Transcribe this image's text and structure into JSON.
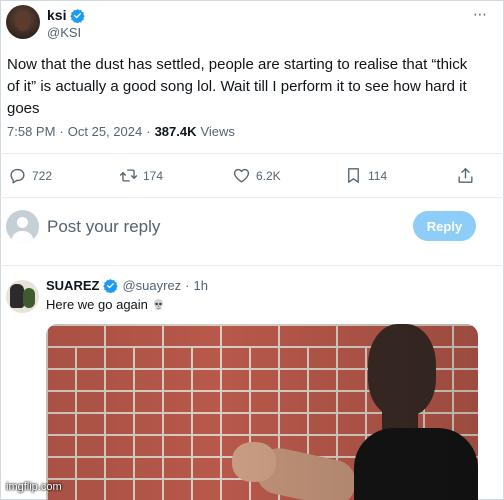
{
  "tweet": {
    "author_name": "ksi",
    "author_handle": "@KSI",
    "text": "Now that the dust has settled, people are starting to realise that “thick of it” is actually a good song lol. Wait till I perform it to see how hard it goes",
    "time": "7:58 PM",
    "date": "Oct 25, 2024",
    "separator": "·",
    "views_count": "387.4K",
    "views_label": "Views",
    "more_icon": "⋯"
  },
  "actions": {
    "replies": "722",
    "reposts": "174",
    "likes": "6.2K",
    "bookmarks": "114"
  },
  "composer": {
    "placeholder": "Post your reply",
    "button_label": "Reply"
  },
  "reply": {
    "author_name": "SUAREZ",
    "author_handle": "@suayrez",
    "separator": "·",
    "time": "1h",
    "text": "Here we go again"
  },
  "watermark": "imgflip.com",
  "colors": {
    "accent": "#1d9bf0",
    "reply_button": "#8ecdf7",
    "secondary_text": "#536471",
    "brick": "#b7584a"
  },
  "icons": [
    "verified-badge-icon",
    "more-icon",
    "reply-icon",
    "repost-icon",
    "like-icon",
    "bookmark-icon",
    "share-icon",
    "skull-icon"
  ]
}
